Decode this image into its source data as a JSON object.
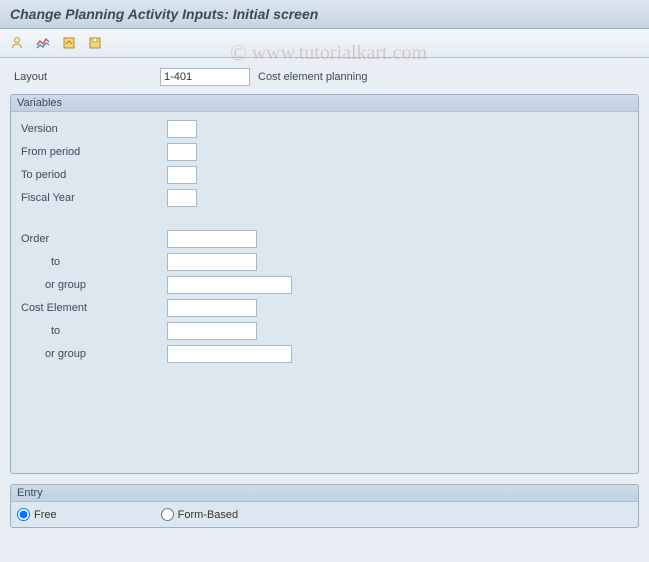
{
  "title": "Change Planning Activity Inputs: Initial screen",
  "watermark": "© www.tutorialkart.com",
  "toolbar": {
    "icons": [
      "user",
      "chart",
      "save-open",
      "save-sheet"
    ]
  },
  "layout": {
    "label": "Layout",
    "value": "1-401",
    "description": "Cost element planning"
  },
  "variables": {
    "legend": "Variables",
    "version": {
      "label": "Version",
      "value": ""
    },
    "from_period": {
      "label": "From period",
      "value": ""
    },
    "to_period": {
      "label": "To period",
      "value": ""
    },
    "fiscal_year": {
      "label": "Fiscal Year",
      "value": ""
    },
    "order": {
      "label": "Order",
      "value": ""
    },
    "order_to": {
      "label": "to",
      "value": ""
    },
    "order_group": {
      "label": "or group",
      "value": ""
    },
    "cost_element": {
      "label": "Cost Element",
      "value": ""
    },
    "ce_to": {
      "label": "to",
      "value": ""
    },
    "ce_group": {
      "label": "or group",
      "value": ""
    }
  },
  "entry": {
    "legend": "Entry",
    "free": "Free",
    "form": "Form-Based",
    "selected": "free"
  }
}
